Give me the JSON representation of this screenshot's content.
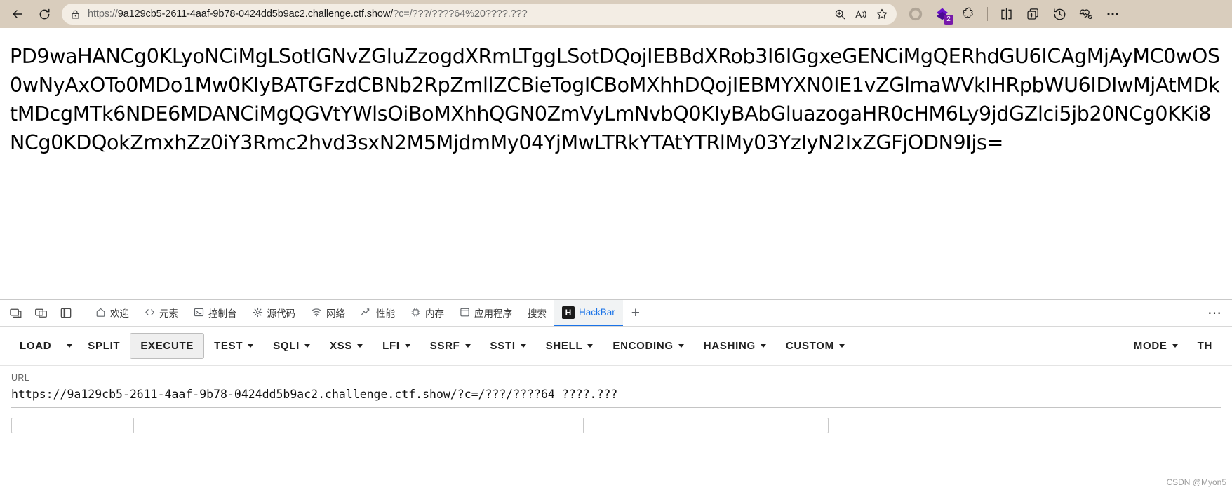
{
  "browser": {
    "back_label": "back-arrow",
    "reload_label": "reload",
    "url_scheme": "https://",
    "url_host": "9a129cb5-2611-4aaf-9b78-0424dd5b9ac2.challenge.ctf.show/",
    "url_query": "?c=/???/????64%20????.???",
    "extension_badge_count": "2",
    "icons": {
      "lock": "lock-icon",
      "zoom": "zoom-icon",
      "read_aloud": "read-aloud-icon",
      "favorite": "star-icon",
      "copilot": "copilot-icon",
      "extensions": "extensions-puzzle-icon",
      "split_screen": "split-screen-icon",
      "add_collection": "add-to-collections-icon",
      "history": "history-icon",
      "browser_essentials": "browser-essentials-icon",
      "settings_more": "settings-and-more-icon"
    }
  },
  "page": {
    "base64_content": "PD9waHANCg0KLyoNCiMgLSotIGNvZGluZzogdXRmLTggLSotDQojIEBBdXRob3I6IGgxeGENCiMgQERhdGU6ICAgMjAyMC0wOS0wNyAxOTo0MDo1Mw0KIyBATGFzdCBNb2RpZmllZCBieTogICBoMXhhDQojIEBMYXN0IE1vZGlmaWVkIHRpbWU6IDIwMjAtMDktMDcgMTk6NDE6MDANCiMgQGVtYWlsOiBoMXhhQGN0ZmVyLmNvbQ0KIyBAbGluazogaHR0cHM6Ly9jdGZlci5jb20NCg0KKi8NCg0KDQokZmxhZz0iY3Rmc2hvd3sxN2M5MjdmMy04YjMwLTRkYTAtYTRlMy03YzIyN2IxZGFjODN9Ijs="
  },
  "devtools": {
    "left_icons": [
      "inspect-device-icon",
      "dock-side-icon",
      "panel-layout-icon"
    ],
    "tabs": [
      {
        "label": "欢迎",
        "icon": "home-icon",
        "active": false
      },
      {
        "label": "元素",
        "icon": "code-brackets-icon",
        "active": false
      },
      {
        "label": "控制台",
        "icon": "console-icon",
        "active": false
      },
      {
        "label": "源代码",
        "icon": "sources-icon",
        "active": false
      },
      {
        "label": "网络",
        "icon": "network-wifi-icon",
        "active": false
      },
      {
        "label": "性能",
        "icon": "performance-icon",
        "active": false
      },
      {
        "label": "内存",
        "icon": "memory-icon",
        "active": false
      },
      {
        "label": "应用程序",
        "icon": "application-icon",
        "active": false
      },
      {
        "label": "搜索",
        "icon": "",
        "active": false
      },
      {
        "label": "HackBar",
        "icon": "hackbar-logo",
        "active": true
      }
    ],
    "add_tab_label": "+",
    "more_label": "⋯"
  },
  "hackbar": {
    "buttons": [
      {
        "label": "LOAD",
        "caret": true,
        "split": true,
        "boxed": false
      },
      {
        "label": "SPLIT",
        "caret": false,
        "boxed": false
      },
      {
        "label": "EXECUTE",
        "caret": false,
        "boxed": true
      },
      {
        "label": "TEST",
        "caret": true,
        "boxed": false
      },
      {
        "label": "SQLI",
        "caret": true,
        "boxed": false
      },
      {
        "label": "XSS",
        "caret": true,
        "boxed": false
      },
      {
        "label": "LFI",
        "caret": true,
        "boxed": false
      },
      {
        "label": "SSRF",
        "caret": true,
        "boxed": false
      },
      {
        "label": "SSTI",
        "caret": true,
        "boxed": false
      },
      {
        "label": "SHELL",
        "caret": true,
        "boxed": false
      },
      {
        "label": "ENCODING",
        "caret": true,
        "boxed": false
      },
      {
        "label": "HASHING",
        "caret": true,
        "boxed": false
      },
      {
        "label": "CUSTOM",
        "caret": true,
        "boxed": false
      }
    ],
    "right_buttons": [
      {
        "label": "MODE",
        "caret": true
      },
      {
        "label": "TH",
        "caret": false
      }
    ],
    "url_label": "URL",
    "url_value": "https://9a129cb5-2611-4aaf-9b78-0424dd5b9ac2.challenge.ctf.show/?c=/???/????64 ????.???"
  },
  "watermark": "CSDN @Myon5"
}
